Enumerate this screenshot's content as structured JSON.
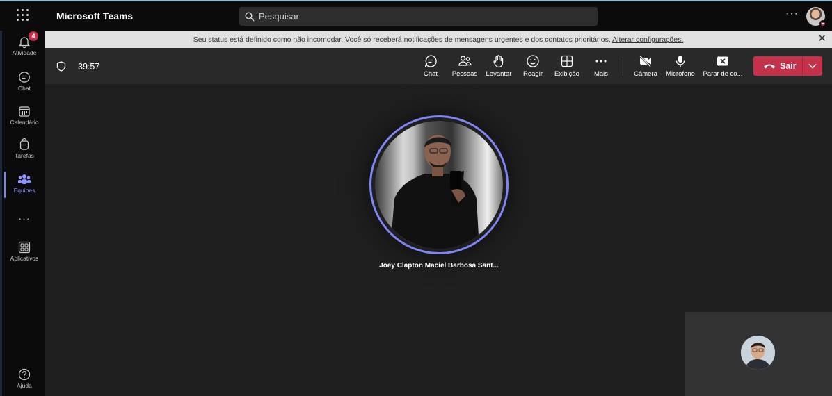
{
  "app": {
    "title": "Microsoft Teams"
  },
  "search": {
    "placeholder": "Pesquisar"
  },
  "rail": {
    "items": [
      {
        "label": "Atividade",
        "badge": "4"
      },
      {
        "label": "Chat"
      },
      {
        "label": "Calendário"
      },
      {
        "label": "Tarefas"
      },
      {
        "label": "Equipes",
        "active": true
      },
      {
        "label": "Aplicativos"
      },
      {
        "label": "Ajuda"
      }
    ]
  },
  "banner": {
    "text": "Seu status está definido como não incomodar. Você só receberá notificações de mensagens urgentes e dos contatos prioritários.",
    "link": "Alterar configurações."
  },
  "meeting": {
    "timer": "39:57",
    "buttons": {
      "chat": "Chat",
      "people": "Pessoas",
      "raise": "Levantar",
      "react": "Reagir",
      "view": "Exibição",
      "more": "Mais",
      "camera": "Câmera",
      "mic": "Microfone",
      "share": "Parar de co..."
    },
    "leave_label": "Sair"
  },
  "stage": {
    "participant_name": "Joey Clapton Maciel Barbosa Sant..."
  },
  "colors": {
    "accent": "#7f85f5",
    "leave": "#c4314b",
    "banner": "#e1e1e1"
  }
}
